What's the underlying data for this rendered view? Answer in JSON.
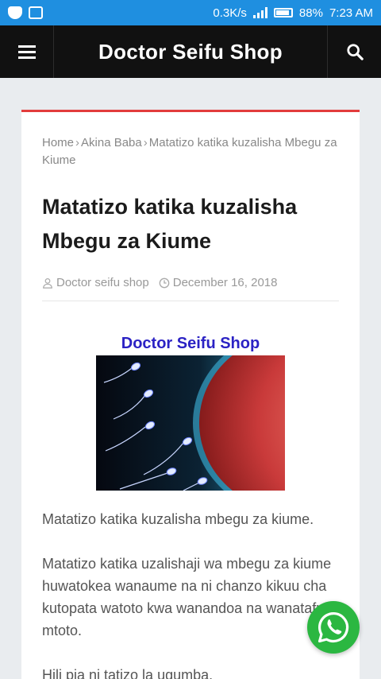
{
  "status_bar": {
    "speed": "0.3K/s",
    "battery": "88%",
    "time": "7:23 AM"
  },
  "header": {
    "site_title": "Doctor Seifu Shop"
  },
  "breadcrumb": {
    "home": "Home",
    "category": "Akina Baba",
    "current": "Matatizo katika kuzalisha Mbegu za Kiume"
  },
  "article": {
    "title": "Matatizo katika kuzalisha Mbegu za Kiume",
    "author": "Doctor seifu shop",
    "date": "December 16, 2018",
    "image_caption": "Doctor Seifu Shop",
    "paragraphs": [
      "Matatizo katika kuzalisha mbegu za kiume.",
      "Matatizo katika uzalishaji wa mbegu za kiume huwatokea wanaume na ni chanzo kikuu cha kutopata watoto kwa wanandoa na wanatafuta mtoto.",
      "Hili pia ni tatizo la ugumba."
    ]
  },
  "colors": {
    "accent": "#e23c3c",
    "status_bar": "#1f8fe0",
    "whatsapp": "#2bb741"
  },
  "icons": [
    "menu-icon",
    "search-icon",
    "user-icon",
    "clock-icon",
    "whatsapp-icon"
  ]
}
